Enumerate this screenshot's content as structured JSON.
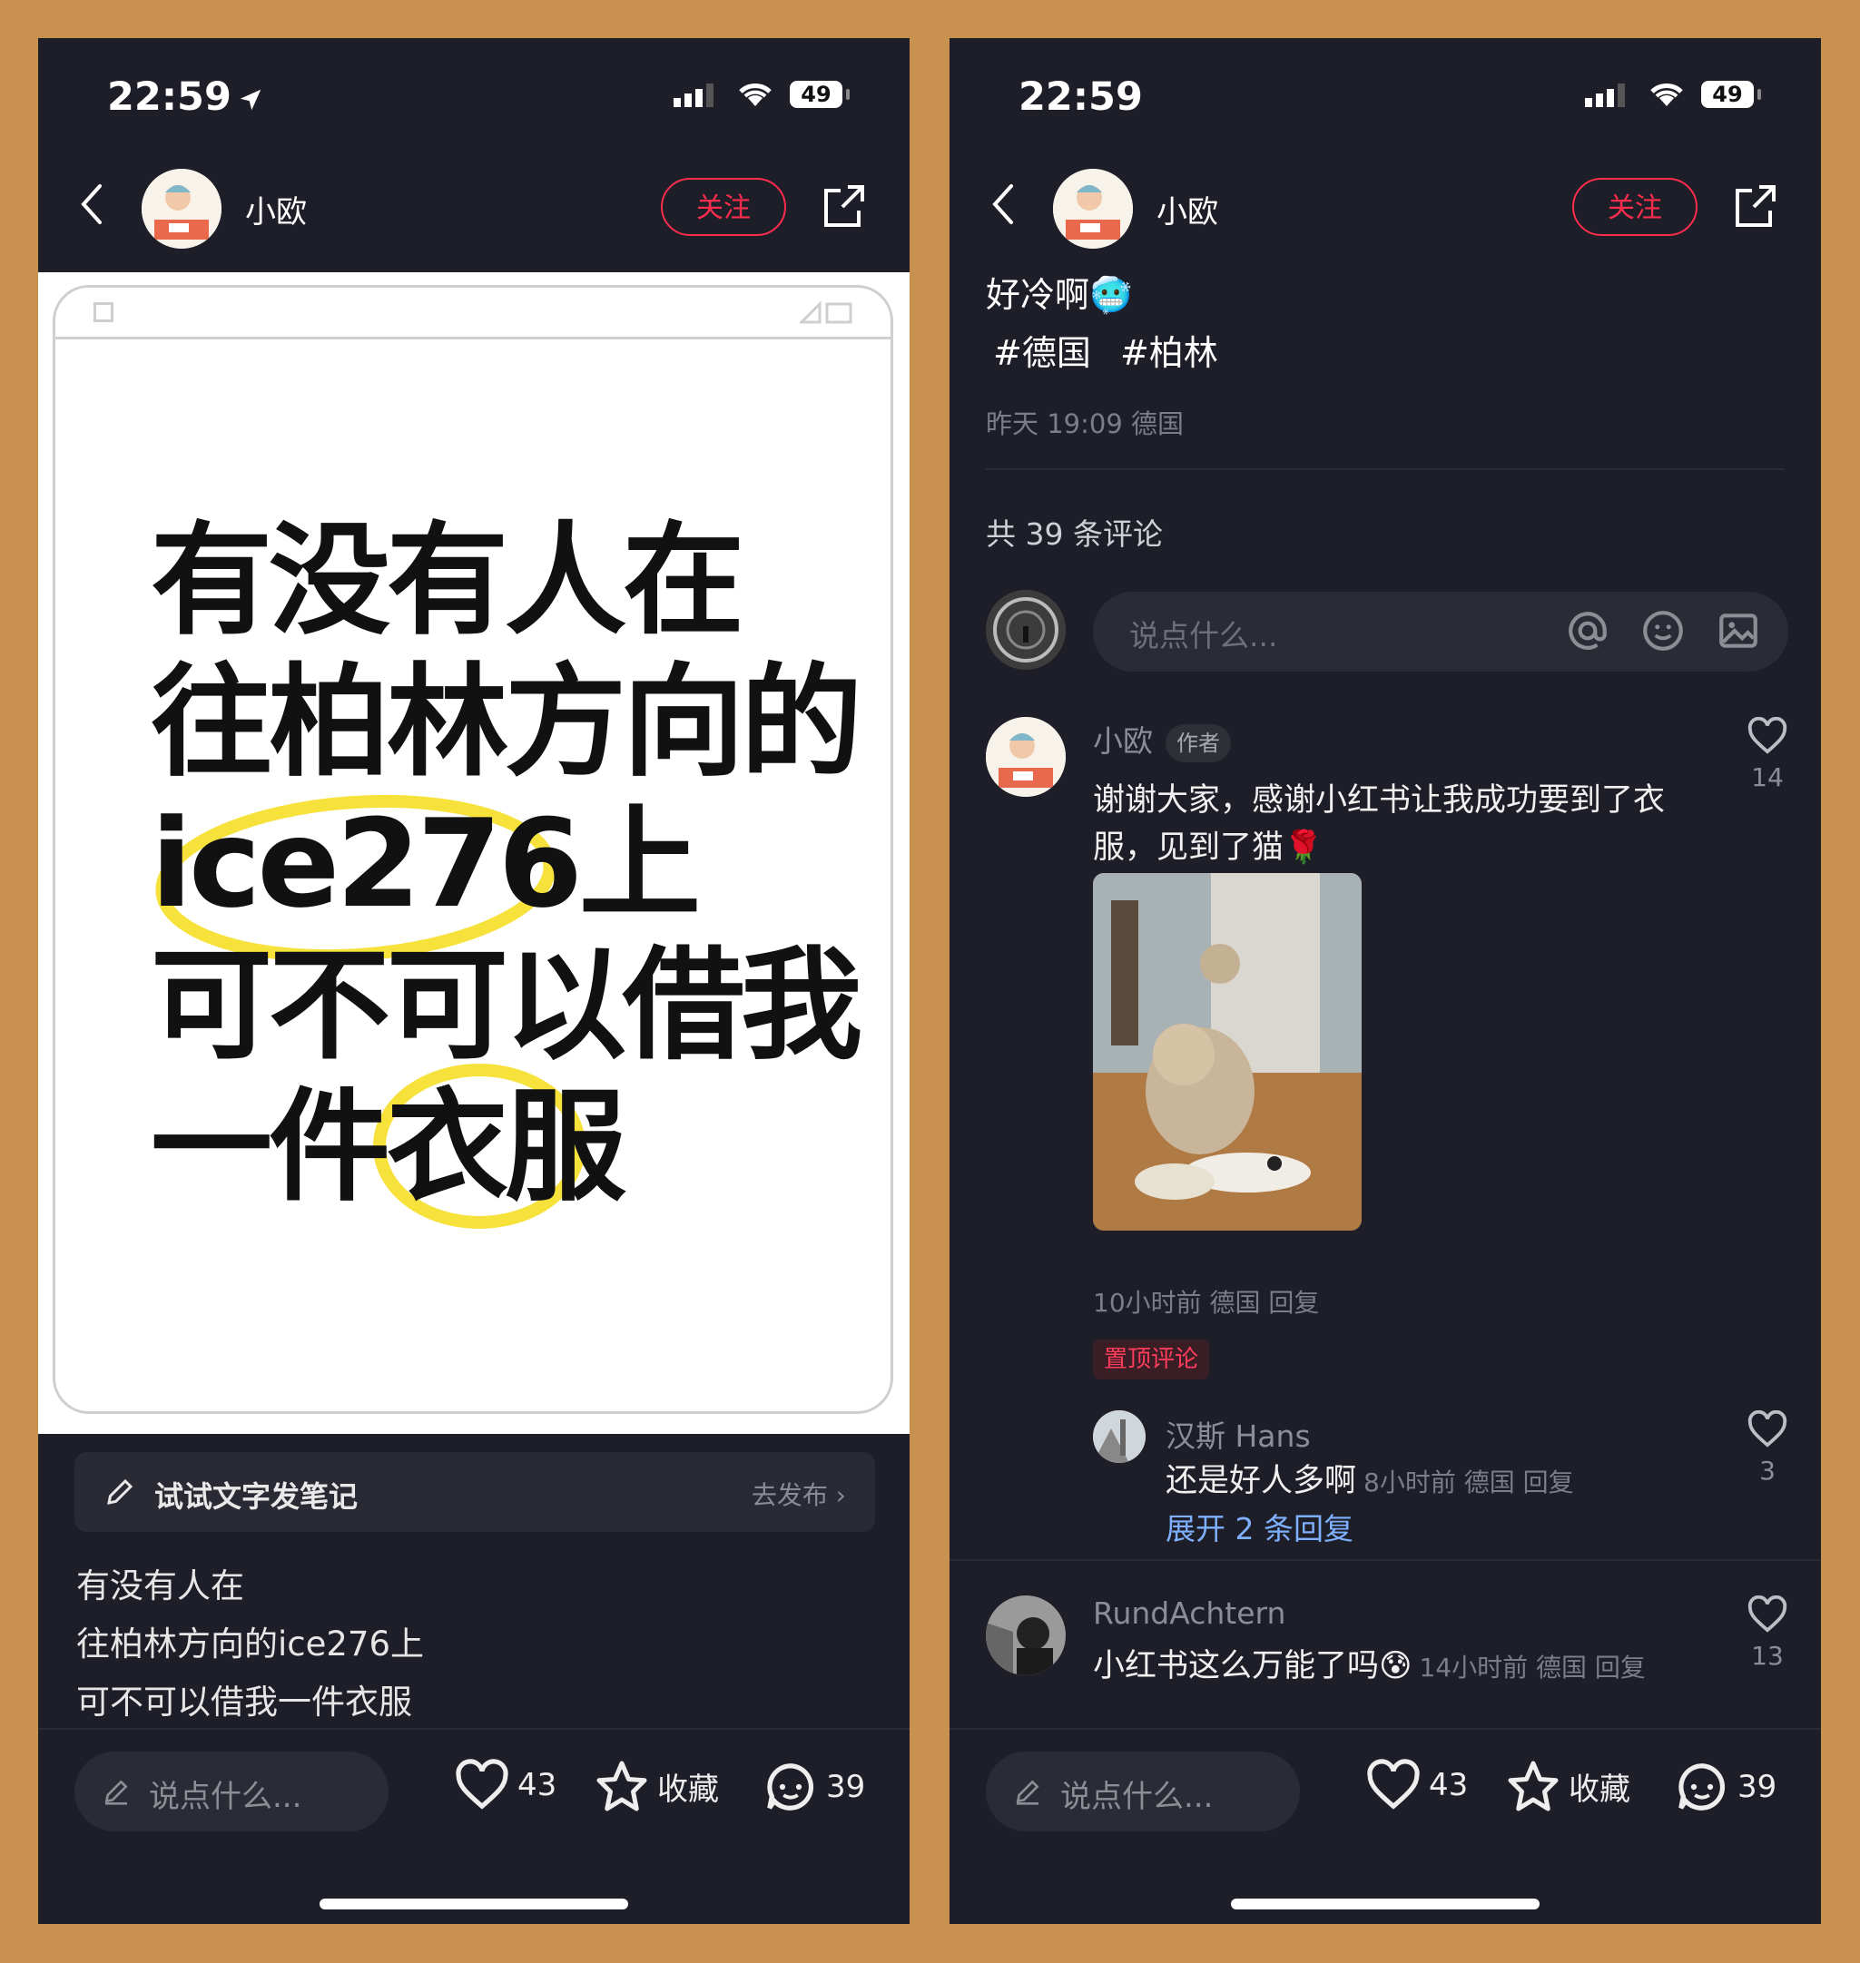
{
  "status_bar": {
    "time": "22:59",
    "battery": "49"
  },
  "header": {
    "author": "小欧",
    "follow_label": "关注"
  },
  "left_screen": {
    "image_text_lines": [
      "有没有人在",
      "往柏林方向的",
      "ice276上",
      "可不可以借我",
      "一件衣服"
    ],
    "draft_prompt": "试试文字发笔记",
    "draft_action": "去发布",
    "caption_lines": [
      "有没有人在",
      "往柏林方向的ice276上",
      "可不可以借我一件衣服"
    ]
  },
  "right_screen": {
    "title": "好冷啊🥶",
    "tags": [
      "#德国",
      "#柏林"
    ],
    "meta": "昨天 19:09 德国",
    "comment_count": "共 39 条评论",
    "input_placeholder": "说点什么...",
    "comments": [
      {
        "name": "小欧",
        "badge": "作者",
        "text_line1": "谢谢大家，感谢小红书让我成功要到了衣",
        "text_line2": "服，见到了猫🌹",
        "meta": "10小时前 德国 回复",
        "likes": "14",
        "pinned": "置顶评论"
      },
      {
        "name": "汉斯 Hans",
        "text": "还是好人多啊",
        "meta": "8小时前 德国 回复",
        "likes": "3",
        "expand": "展开 2 条回复"
      },
      {
        "name": "RundAchtern",
        "text": "小红书这么万能了吗😰",
        "meta": "14小时前 德国 回复",
        "likes": "13"
      }
    ]
  },
  "bottom_bar": {
    "placeholder": "说点什么...",
    "likes": "43",
    "collect_label": "收藏",
    "comments": "39"
  },
  "colors": {
    "accent": "#ff2d4d",
    "background": "#1e1e28",
    "frame": "#c8914f",
    "highlight": "#f6e23a"
  }
}
